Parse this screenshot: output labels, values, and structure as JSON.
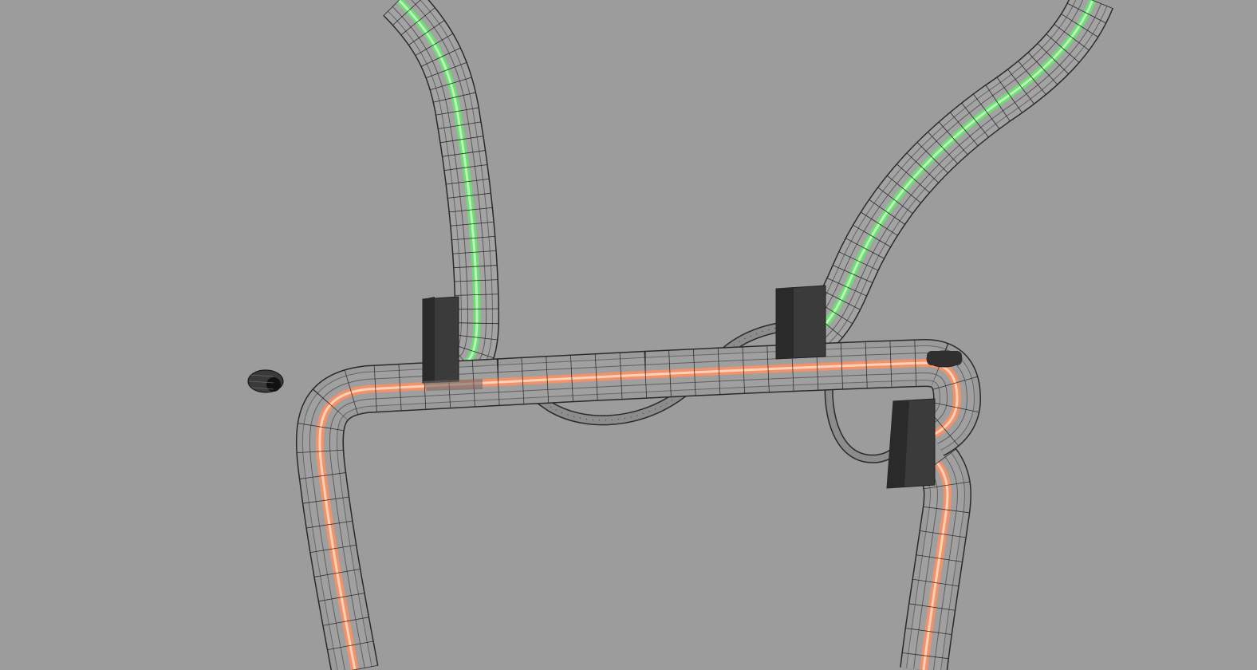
{
  "viewport": {
    "background": "#9c9c9c",
    "wire_color": "#2a2a2a",
    "tube_fill": "rgba(150,150,150,0.35)"
  },
  "hoses": [
    {
      "id": "hose-left-green",
      "core_color": "#6fdc74",
      "highlight": "#b8f5b8"
    },
    {
      "id": "hose-right-green",
      "core_color": "#6fdc74",
      "highlight": "#b8f5b8"
    },
    {
      "id": "hose-orange-frame",
      "core_color": "#f0926a",
      "highlight": "#ffd0b8"
    },
    {
      "id": "thin-cable-under",
      "core_color": "#8a8a8a",
      "highlight": "#bdbdbd"
    },
    {
      "id": "thin-cable-right",
      "core_color": "#8a8a8a",
      "highlight": "#bdbdbd"
    }
  ],
  "clamps": [
    {
      "id": "clamp-left",
      "color": "#3a3a3a"
    },
    {
      "id": "clamp-middle",
      "color": "#3a3a3a"
    },
    {
      "id": "clamp-right",
      "color": "#3a3a3a"
    },
    {
      "id": "end-cap",
      "color": "#333333"
    }
  ]
}
